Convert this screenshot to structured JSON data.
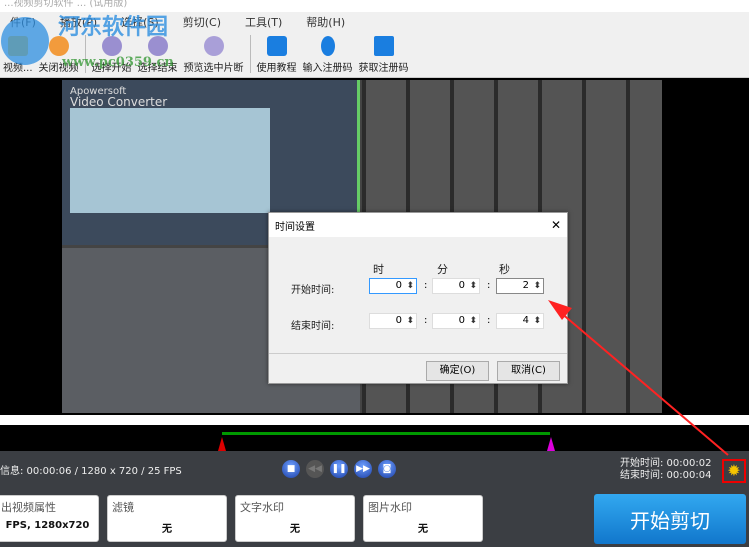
{
  "title": "...视频剪切软件 ... (试用版)",
  "watermark": {
    "name": "河东软件园",
    "url": "www.pc0359.cn"
  },
  "menu": [
    "件(F)",
    "播放(P)",
    "选择(S)",
    "剪切(C)",
    "工具(T)",
    "帮助(H)"
  ],
  "toolbar": [
    "视频...",
    "关闭视频",
    "选择开始",
    "选择结束",
    "预览选中片断",
    "使用教程",
    "输入注册码",
    "获取注册码"
  ],
  "video": {
    "overlay_brand": "Apowersoft",
    "overlay_product": "Video Converter"
  },
  "dialog": {
    "title": "时间设置",
    "close": "✕",
    "col_hour": "时",
    "col_min": "分",
    "col_sec": "秒",
    "start_label": "开始时间:",
    "end_label": "结束时间:",
    "start": {
      "h": "0",
      "m": "0",
      "s": "2"
    },
    "end": {
      "h": "0",
      "m": "0",
      "s": "4"
    },
    "colon": ":",
    "ok": "确定(O)",
    "cancel": "取消(C)"
  },
  "info": "信息: 00:00:06 / 1280 x 720 / 25 FPS",
  "controls": [
    "■",
    "◀◀",
    "❚❚",
    "▶▶",
    "◙"
  ],
  "times": {
    "start": "开始时间: 00:00:02",
    "end": "结束时间: 00:00:04"
  },
  "gear": "✹",
  "cards": [
    {
      "title": "出视频属性",
      "value": "FPS, 1280x720"
    },
    {
      "title": "滤镜",
      "value": "无"
    },
    {
      "title": "文字水印",
      "value": "无"
    },
    {
      "title": "图片水印",
      "value": "无"
    }
  ],
  "start_button": "开始剪切"
}
